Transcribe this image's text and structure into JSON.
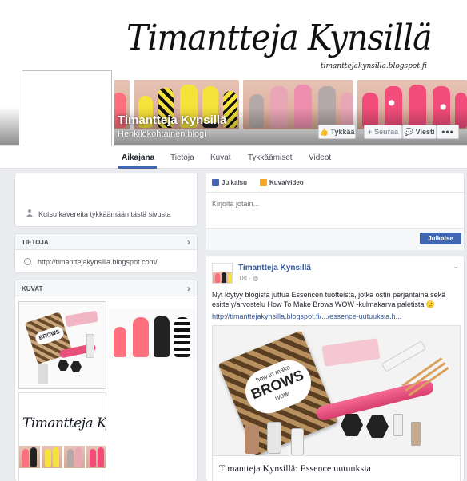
{
  "cover": {
    "title": "Timantteja Kynsillä",
    "blog_url": "timanttejakynsilla.blogspot.fi",
    "page_name": "Timantteja Kynsillä",
    "page_category": "Henkilökohtainen blogi",
    "buttons": {
      "like": "Tykkää",
      "follow": "Seuraa",
      "message": "Viesti",
      "more": "•••"
    }
  },
  "tabs": [
    "Aikajana",
    "Tietoja",
    "Kuvat",
    "Tykkäämiset",
    "Videot"
  ],
  "left": {
    "invite_text": "Kutsu kavereita tykkäämään tästä sivusta",
    "about": {
      "header": "TIETOJA",
      "link": "http://timanttejakynsilla.blogspot.com/"
    },
    "photos": {
      "header": "KUVAT"
    }
  },
  "composer": {
    "tab_status": "Julkaisu",
    "tab_photo": "Kuva/video",
    "placeholder": "Kirjoita jotain...",
    "post_button": "Julkaise"
  },
  "post": {
    "author": "Timantteja Kynsillä",
    "time": "18t ·",
    "text": "Nyt löytyy blogista juttua Essencen tuotteista, jotka ostin perjantaina sekä esittely/arvostelu How To Make Brows WOW -kulmakarva paletista 🙂",
    "link": "http://timanttejakynsilla.blogspot.fi/.../essence-uutuuksia.h...",
    "image_text": {
      "brand_top": "how to make",
      "brand_main": "BROWS",
      "brand_sub": "wow"
    },
    "link_title": "Timantteja Kynsillä: Essence uutuuksia"
  },
  "colors": {
    "accent": "#4267b2",
    "link": "#365899",
    "background": "#e9ebee"
  }
}
